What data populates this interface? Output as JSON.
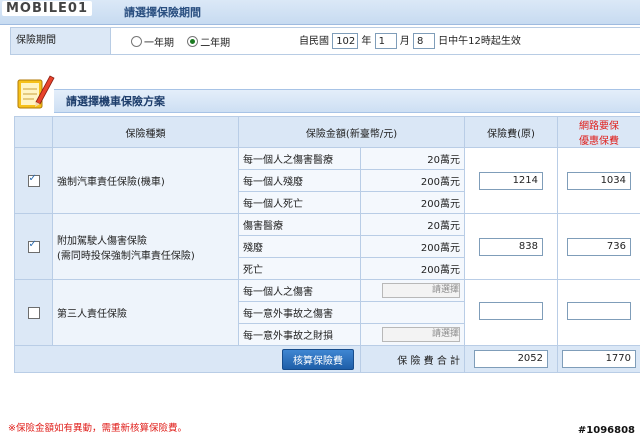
{
  "watermark": "MOBILE01",
  "period_section": {
    "title": "請選擇保險期間"
  },
  "period": {
    "label": "保險期間",
    "options": [
      {
        "label": "一年期",
        "selected": false
      },
      {
        "label": "二年期",
        "selected": true
      }
    ],
    "date_prefix": "自民國",
    "year": "102",
    "year_unit": "年",
    "month": "1",
    "month_unit": "月",
    "day": "8",
    "day_suffix": "日中午12時起生效"
  },
  "plan_section": {
    "title": "請選擇機車保險方案"
  },
  "table": {
    "headers": {
      "type": "保險種類",
      "coverage": "保險金額(新臺幣/元)",
      "premium": "保險費(原)",
      "online_line1": "網路要保",
      "online_line2": "優惠保費"
    },
    "rows": [
      {
        "checked": true,
        "type_line1": "強制汽車責任保險(機車)",
        "type_line2": "",
        "coverages": [
          {
            "label": "每一個人之傷害醫療",
            "value": "20萬元"
          },
          {
            "label": "每一個人殘廢",
            "value": "200萬元"
          },
          {
            "label": "每一個人死亡",
            "value": "200萬元"
          }
        ],
        "premium": "1214",
        "online": "1034"
      },
      {
        "checked": true,
        "type_line1": "附加駕駛人傷害保險",
        "type_line2": "(需同時投保強制汽車責任保險)",
        "coverages": [
          {
            "label": "傷害醫療",
            "value": "20萬元"
          },
          {
            "label": "殘廢",
            "value": "200萬元"
          },
          {
            "label": "死亡",
            "value": "200萬元"
          }
        ],
        "premium": "838",
        "online": "736"
      },
      {
        "checked": false,
        "type_line1": "第三人責任保險",
        "type_line2": "",
        "coverages": [
          {
            "label": "每一個人之傷害",
            "select": "請選擇"
          },
          {
            "label": "每一意外事故之傷害",
            "value": ""
          },
          {
            "label": "每一意外事故之財損",
            "select": "請選擇"
          }
        ],
        "premium": "",
        "online": ""
      }
    ],
    "total": {
      "button": "核算保險費",
      "label": "保 險 費 合 計",
      "premium": "2052",
      "online": "1770"
    }
  },
  "note": "※保險金額如有異動，需重新核算保險費。",
  "post_id": "#1096808",
  "colors": {
    "accent_red": "#e0201c",
    "header_blue": "#dae7f6",
    "button_blue": "#1e5ea8"
  }
}
